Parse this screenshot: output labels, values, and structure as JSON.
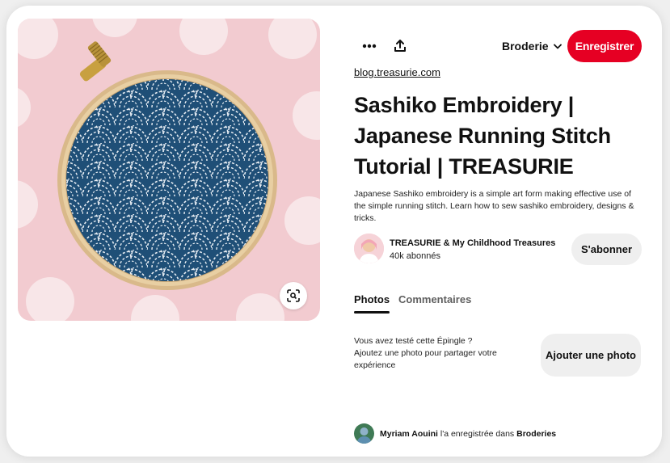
{
  "toolbar": {
    "more_icon": "more-horizontal-icon",
    "share_icon": "share-upload-icon",
    "board_name": "Broderie",
    "save_label": "Enregistrer"
  },
  "pin": {
    "source": "blog.treasurie.com",
    "title": "Sashiko Embroidery | Japanese Running Stitch Tutorial | TREASURIE",
    "description": "Japanese Sashiko embroidery is a simple art form making effective use of the simple running stitch. Learn how to sew sashiko embroidery, designs & tricks."
  },
  "creator": {
    "name": "TREASURIE & My Childhood Treasures",
    "followers": "40k abonnés",
    "follow_label": "S'abonner"
  },
  "tabs": {
    "photos": "Photos",
    "comments": "Commentaires"
  },
  "tried": {
    "question": "Vous avez testé cette Épingle ?",
    "prompt": "Ajoutez une photo pour partager votre expérience",
    "add_photo_label": "Ajouter une photo"
  },
  "activity": {
    "user": "Myriam Aouini",
    "text": " l'a enregistrée dans ",
    "board": "Broderies"
  },
  "colors": {
    "accent": "#e60023",
    "button_gray": "#efefef",
    "fabric_blue": "#1d4e75",
    "background_pink": "#f2cbd0"
  }
}
